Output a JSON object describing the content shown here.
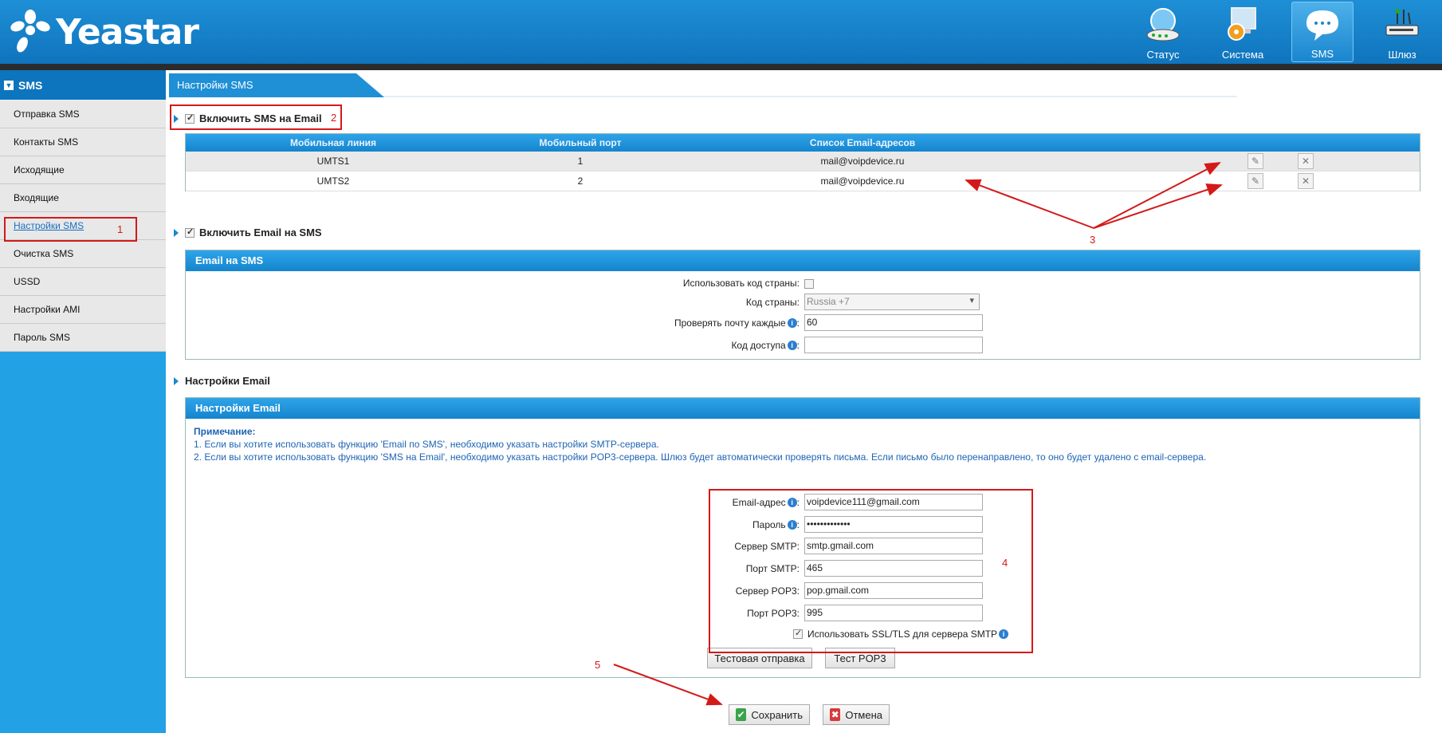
{
  "header": {
    "logo_text": "Yeastar",
    "nav": [
      {
        "label": "Статус",
        "icon": "status-icon"
      },
      {
        "label": "Система",
        "icon": "system-icon"
      },
      {
        "label": "SMS",
        "icon": "sms-icon",
        "active": true
      },
      {
        "label": "Шлюз",
        "icon": "gateway-icon"
      }
    ]
  },
  "sidebar": {
    "title": "SMS",
    "items": [
      {
        "label": "Отправка SMS"
      },
      {
        "label": "Контакты SMS"
      },
      {
        "label": "Исходящие"
      },
      {
        "label": "Входящие"
      },
      {
        "label": "Настройки SMS",
        "current": true
      },
      {
        "label": "Очистка SMS"
      },
      {
        "label": "USSD"
      },
      {
        "label": "Настройки AMI"
      },
      {
        "label": "Пароль SMS"
      }
    ]
  },
  "page_title": "Настройки SMS",
  "sms_to_email": {
    "label": "Включить SMS на Email",
    "checked": true,
    "columns": [
      "Мобильная линия",
      "Мобильный порт",
      "Список Email-адресов"
    ],
    "rows": [
      {
        "line": "UMTS1",
        "port": "1",
        "emails": "mail@voipdevice.ru"
      },
      {
        "line": "UMTS2",
        "port": "2",
        "emails": "mail@voipdevice.ru"
      }
    ]
  },
  "email_to_sms": {
    "label": "Включить Email на SMS",
    "checked": true,
    "panel_title": "Email на SMS",
    "use_country_code_label": "Использовать код страны:",
    "country_code_label": "Код страны:",
    "country_code_value": "Russia +7",
    "check_mail_label": "Проверять почту каждые",
    "check_mail_value": "60",
    "access_code_label": "Код доступа",
    "access_code_value": ""
  },
  "email_settings": {
    "section_label": "Настройки Email",
    "panel_title": "Настройки Email",
    "note_title": "Примечание:",
    "note_1": "1. Если вы хотите использовать функцию 'Email по SMS', необходимо указать настройки SMTP-сервера.",
    "note_2": "2. Если вы хотите использовать функцию 'SMS на Email', необходимо указать настройки POP3-сервера. Шлюз будет автоматически проверять письма. Если письмо было перенаправлено, то оно будет удалено с email-сервера.",
    "email_label": "Email-адрес",
    "email_value": "voipdevice111@gmail.com",
    "password_label": "Пароль",
    "password_value": "•••••••••••••",
    "smtp_server_label": "Сервер SMTP:",
    "smtp_server_value": "smtp.gmail.com",
    "smtp_port_label": "Порт SMTP:",
    "smtp_port_value": "465",
    "pop3_server_label": "Сервер POP3:",
    "pop3_server_value": "pop.gmail.com",
    "pop3_port_label": "Порт POP3:",
    "pop3_port_value": "995",
    "ssl_label": "Использовать SSL/TLS для сервера SMTP",
    "test_send_label": "Тестовая отправка",
    "test_pop3_label": "Тест POP3"
  },
  "buttons": {
    "save_label": "Сохранить",
    "cancel_label": "Отмена"
  },
  "annotations": {
    "n1": "1",
    "n2": "2",
    "n3": "3",
    "n4": "4",
    "n5": "5",
    "color": "#d41919"
  }
}
